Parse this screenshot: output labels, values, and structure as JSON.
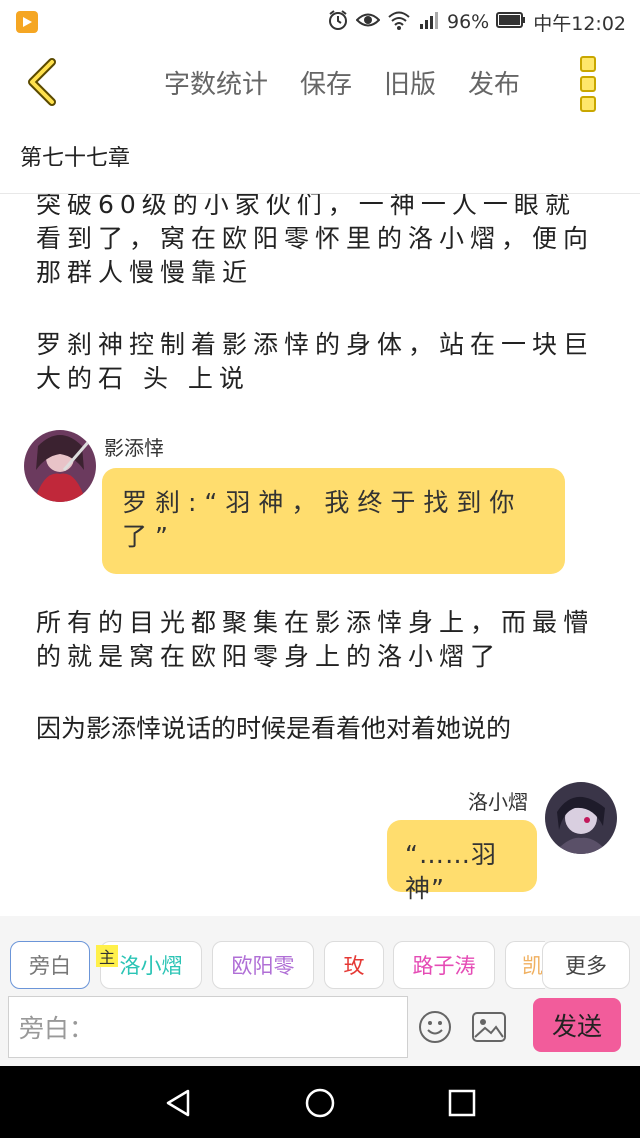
{
  "status": {
    "battery": "96%",
    "time": "中午12:02"
  },
  "toolbar": {
    "actions": [
      "字数统计",
      "保存",
      "旧版",
      "发布"
    ]
  },
  "chapter": {
    "title": "第七十七章"
  },
  "content": {
    "para1": "突破60级的小家伙们，一神一人一眼就看到了，窝在欧阳零怀里的洛小熠，便向那群人慢慢靠近",
    "para2": " 罗刹神控制着影添悻的身体，站在一块巨大的石 头 上说",
    "msg1": {
      "speaker": "影添悻",
      "text": "罗刹:“羽神，我终于找到你了”"
    },
    "para3": "所有的目光都聚集在影添悻身上，而最懵的就是窝在欧阳零身上的洛小熠了",
    "para4": "因为影添悻说话的时候是看着他对着她说的",
    "msg2": {
      "speaker": "洛小熠",
      "text": "“……羽神”"
    }
  },
  "characters": {
    "main_tag": "主",
    "chips": [
      {
        "label": "旁白",
        "color": "#777777"
      },
      {
        "label": "洛小熠",
        "color": "#2bc4b5"
      },
      {
        "label": "欧阳零",
        "color": "#b06fd6"
      },
      {
        "label": "玫",
        "color": "#e53935"
      },
      {
        "label": "路子涛",
        "color": "#e54bb5"
      },
      {
        "label": "凯",
        "color": "#f0b060"
      }
    ],
    "more": "更多"
  },
  "input": {
    "placeholder": "旁白："
  },
  "send_label": "发送"
}
